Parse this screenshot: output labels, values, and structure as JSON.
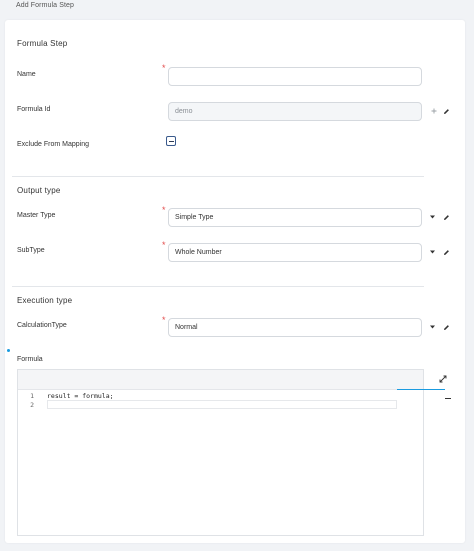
{
  "page": {
    "title": "Add Formula Step"
  },
  "formula_step": {
    "section_title": "Formula Step",
    "name": {
      "label": "Name",
      "value": "",
      "required": true
    },
    "formula_id": {
      "label": "Formula Id",
      "value": "demo"
    },
    "exclude_from_mapping": {
      "label": "Exclude From Mapping",
      "state": "indeterminate"
    }
  },
  "output_type": {
    "section_title": "Output type",
    "master_type": {
      "label": "Master Type",
      "value": "Simple Type",
      "required": true
    },
    "sub_type": {
      "label": "SubType",
      "value": "Whole Number",
      "required": true
    }
  },
  "execution_type": {
    "section_title": "Execution type",
    "calculation_type": {
      "label": "CalculationType",
      "value": "Normal",
      "required": true
    }
  },
  "formula": {
    "label": "Formula",
    "lines": [
      {
        "no": "1",
        "text": "result = formula;"
      },
      {
        "no": "2",
        "text": ""
      }
    ]
  },
  "icons": {
    "dropdown": "chevron-down-icon",
    "edit": "pencil-icon",
    "add": "plus-icon",
    "expand": "expand-icon"
  },
  "colors": {
    "required": "#e24b4b",
    "accent": "#1a9be0"
  }
}
